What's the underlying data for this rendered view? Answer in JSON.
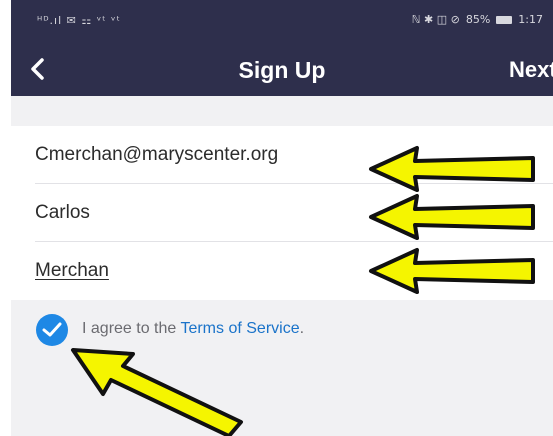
{
  "status_bar": {
    "left_indicators": "ᴴᴰ.ıl ✉ ⚏ ᵛᵗ ᵛᵗ",
    "right_indicators": "ℕ ✱ ◫ ⊘",
    "battery": "85%",
    "time": "1:17"
  },
  "header": {
    "title": "Sign Up",
    "next_label": "Next"
  },
  "form": {
    "email": "Cmerchan@maryscenter.org",
    "first_name": "Carlos",
    "last_name": "Merchan"
  },
  "agreement": {
    "prefix": "I agree to the ",
    "link": "Terms of Service",
    "suffix": "."
  },
  "colors": {
    "header_bg": "#2e2f4c",
    "accent": "#1e88e5",
    "annotation_arrow": "#f5f500"
  }
}
